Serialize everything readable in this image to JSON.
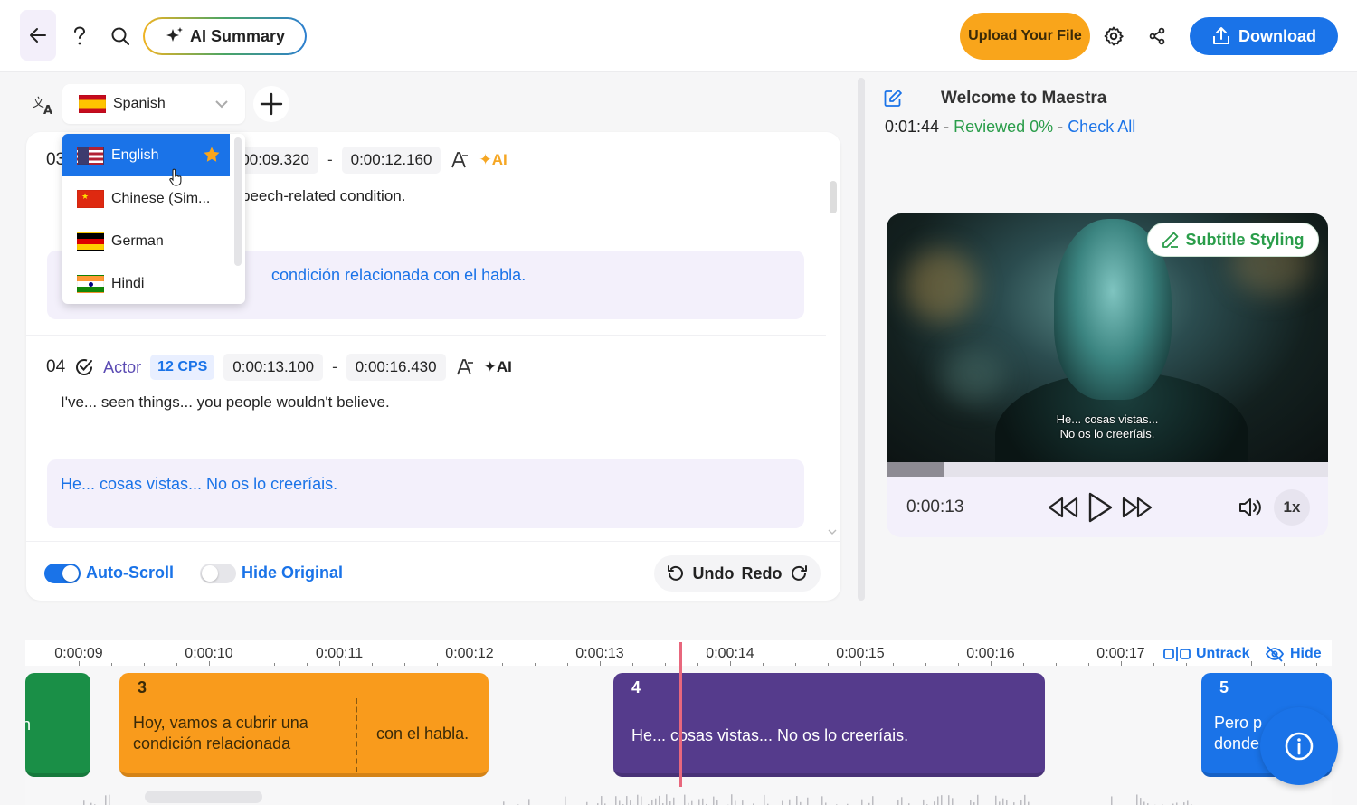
{
  "header": {
    "ai_summary_label": "AI Summary",
    "upload_label": "Upload Your File",
    "download_label": "Download"
  },
  "language": {
    "selected": "Spanish",
    "options": [
      {
        "label": "English",
        "flag": "us",
        "favorite": true
      },
      {
        "label": "Chinese (Sim...",
        "flag": "cn"
      },
      {
        "label": "German",
        "flag": "de"
      },
      {
        "label": "Hindi",
        "flag": "in"
      }
    ]
  },
  "segments": [
    {
      "number": "03",
      "start": "0:00:09.320",
      "end": "0:00:12.160",
      "original": "peech-related condition.",
      "translation": "condición relacionada con el habla."
    },
    {
      "number": "04",
      "actor": "Actor",
      "cps": "12 CPS",
      "start": "0:00:13.100",
      "end": "0:00:16.430",
      "original": "I've... seen things... you people wouldn't believe.",
      "translation": "He... cosas vistas... No os lo creeríais."
    }
  ],
  "segment_dash": "-",
  "ai_tag": "AI",
  "footer": {
    "auto_scroll_label": "Auto-Scroll",
    "auto_scroll_on": true,
    "hide_original_label": "Hide Original",
    "hide_original_on": false,
    "undo_label": "Undo",
    "redo_label": "Redo"
  },
  "project": {
    "title": "Welcome to Maestra",
    "duration": "0:01:44",
    "sep": "-",
    "reviewed": "Reviewed 0%",
    "check_all": "Check All"
  },
  "player": {
    "subtitle_styling_label": "Subtitle Styling",
    "caption_line1": "He... cosas vistas...",
    "caption_line2": "No os lo creeríais.",
    "current_time": "0:00:13",
    "speed": "1x",
    "progress_fraction": 0.13
  },
  "timeline": {
    "ticks": [
      "0:00:09",
      "0:00:10",
      "0:00:11",
      "0:00:12",
      "0:00:13",
      "0:00:14",
      "0:00:15",
      "0:00:16",
      "0:00:17"
    ],
    "untrack_label": "Untrack",
    "hide_label": "Hide",
    "blocks": [
      {
        "number": "3",
        "text_a": "Hoy, vamos a cubrir una condición relacionada",
        "text_b": "con el habla."
      },
      {
        "number": "4",
        "text": "He... cosas vistas... No os lo creeríais."
      },
      {
        "number": "5",
        "text_line1": "Pero p",
        "text_line2": "donde"
      }
    ]
  },
  "colors": {
    "accent": "#1a73e8",
    "upload": "#f9a51b",
    "green": "#2a9d4a",
    "block_orange": "#f99b1c",
    "block_purple": "#553b8c",
    "block_green": "#1a8f47",
    "playhead": "#e8677d"
  }
}
